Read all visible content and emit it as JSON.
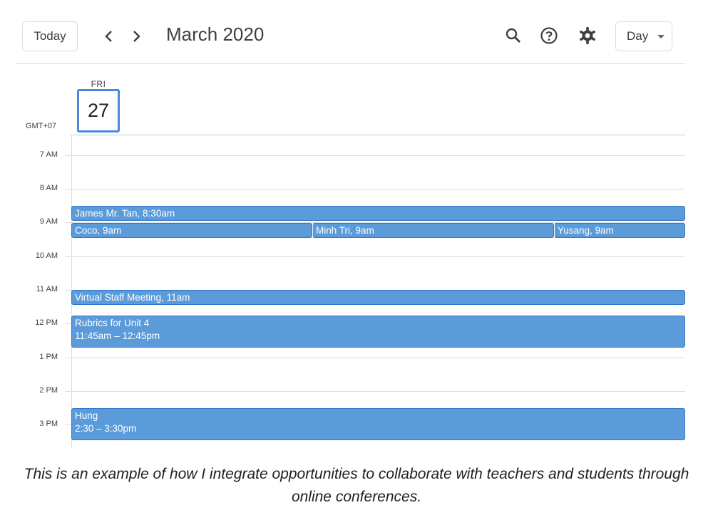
{
  "toolbar": {
    "today_label": "Today",
    "prev_icon": "chevron-left-icon",
    "next_icon": "chevron-right-icon",
    "title": "March 2020",
    "search_icon": "search-icon",
    "help_icon": "help-circle-icon",
    "settings_icon": "gear-icon",
    "view_value": "Day"
  },
  "day_header": {
    "weekday": "FRI",
    "date": "27",
    "timezone": "GMT+07"
  },
  "hours": [
    "7 AM",
    "8 AM",
    "9 AM",
    "10 AM",
    "11 AM",
    "12 PM",
    "1 PM",
    "2 PM",
    "3 PM"
  ],
  "events": [
    {
      "title": "James Mr. Tan",
      "time": ", 8:30am"
    },
    {
      "title": "Coco",
      "time": ", 9am"
    },
    {
      "title": "Minh Tri",
      "time": ", 9am"
    },
    {
      "title": "Yusang",
      "time": ", 9am"
    },
    {
      "title": "Virtual Staff Meeting",
      "time": ", 11am"
    },
    {
      "title": "Rubrics for Unit 4",
      "time": "11:45am – 12:45pm"
    },
    {
      "title": "Hung",
      "time": "2:30 – 3:30pm"
    }
  ],
  "colors": {
    "event_fill": "#5b9bd9",
    "event_border": "#2f78c9",
    "today_highlight": "#4a86e0"
  },
  "caption": "This is an example of how I integrate opportunities to collaborate with teachers and students through online conferences."
}
